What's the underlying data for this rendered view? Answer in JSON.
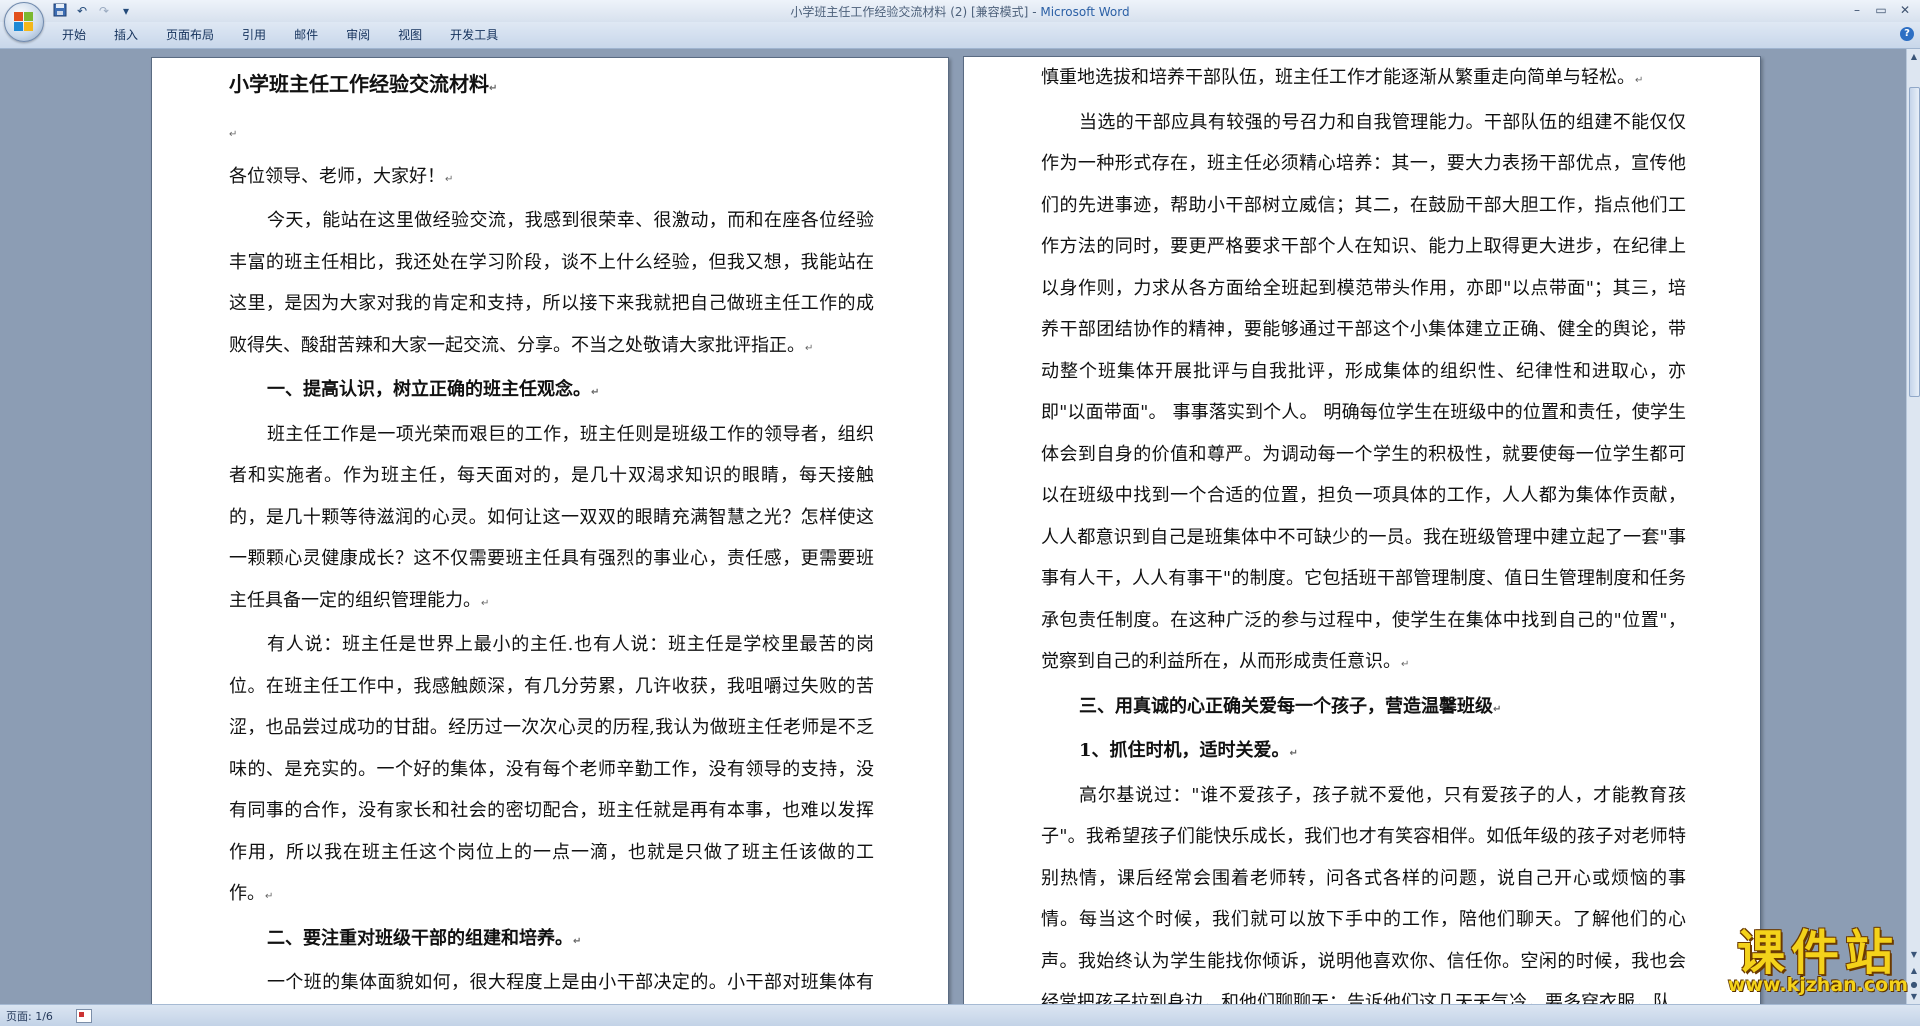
{
  "window": {
    "title": "小学班主任工作经验交流材料 (2) [兼容模式]",
    "title_sep": " - ",
    "app_name": "Microsoft Word",
    "min": "–",
    "max": "▭",
    "close": "✕"
  },
  "qat": {
    "save_icon": "floppy-disk-icon",
    "undo": "↶",
    "redo": "↷",
    "dropdown": "▾"
  },
  "ribbon": {
    "tabs": [
      "开始",
      "插入",
      "页面布局",
      "引用",
      "邮件",
      "审阅",
      "视图",
      "开发工具"
    ],
    "help": "?"
  },
  "left_page": {
    "title": "小学班主任工作经验交流材料",
    "salutation": "各位领导、老师，大家好！",
    "para1": "今天，能站在这里做经验交流，我感到很荣幸、很激动，而和在座各位经验丰富的班主任相比，我还处在学习阶段，谈不上什么经验，但我又想，我能站在这里，是因为大家对我的肯定和支持，所以接下来我就把自己做班主任工作的成败得失、酸甜苦辣和大家一起交流、分享。不当之处敬请大家批评指正。",
    "heading1": "一、提高认识，树立正确的班主任观念。",
    "para2": "班主任工作是一项光荣而艰巨的工作，班主任则是班级工作的领导者，组织者和实施者。作为班主任，每天面对的，是几十双渴求知识的眼睛，每天接触的，是几十颗等待滋润的心灵。如何让这一双双的眼睛充满智慧之光？怎样使这一颗颗心灵健康成长？这不仅需要班主任具有强烈的事业心，责任感，更需要班主任具备一定的组织管理能力。",
    "para3": "有人说：班主任是世界上最小的主任.也有人说：班主任是学校里最苦的岗位。在班主任工作中，我感触颇深，有几分劳累，几许收获，我咀嚼过失败的苦涩，也品尝过成功的甘甜。经历过一次次心灵的历程,我认为做班主任老师是不乏味的、是充实的。一个好的集体，没有每个老师辛勤工作，没有领导的支持，没有同事的合作，没有家长和社会的密切配合，班主任就是再有本事，也难以发挥作用，所以我在班主任这个岗位上的一点一滴，也就是只做了班主任该做的工作。",
    "heading2": "二、要注重对班级干部的组建和培养。",
    "para4": "一个班的集体面貌如何，很大程度上是由小干部决定的。小干部对班集体有着\"以点带面\"和\"以面带面\"的作用，我称他们是\"班主任的左右手。\"所以唯有"
  },
  "right_page": {
    "para1": "慎重地选拔和培养干部队伍，班主任工作才能逐渐从繁重走向简单与轻松。",
    "para2": "当选的干部应具有较强的号召力和自我管理能力。干部队伍的组建不能仅仅作为一种形式存在，班主任必须精心培养：其一，要大力表扬干部优点，宣传他们的先进事迹，帮助小干部树立威信；其二，在鼓励干部大胆工作，指点他们工作方法的同时，要更严格要求干部个人在知识、能力上取得更大进步，在纪律上以身作则，力求从各方面给全班起到模范带头作用，亦即\"以点带面\"；其三，培养干部团结协作的精神，要能够通过干部这个小集体建立正确、健全的舆论，带动整个班集体开展批评与自我批评，形成集体的组织性、纪律性和进取心，亦即\"以面带面\"。 事事落实到个人。 明确每位学生在班级中的位置和责任，使学生体会到自身的价值和尊严。为调动每一个学生的积极性，就要使每一位学生都可以在班级中找到一个合适的位置，担负一项具体的工作，人人都为集体作贡献，人人都意识到自己是班集体中不可缺少的一员。我在班级管理中建立起了一套\"事事有人干，人人有事干\"的制度。它包括班干部管理制度、值日生管理制度和任务承包责任制度。在这种广泛的参与过程中，使学生在集体中找到自己的\"位置\"，觉察到自己的利益所在，从而形成责任意识。",
    "heading3": "三、用真诚的心正确关爱每一个孩子，营造温馨班级",
    "heading3_1": "1、抓住时机，适时关爱。",
    "para3": "高尔基说过：\"谁不爱孩子，孩子就不爱他，只有爱孩子的人，才能教育孩子\"。我希望孩子们能快乐成长，我们也才有笑容相伴。如低年级的孩子对老师特别热情，课后经常会围着老师转，问各式各样的问题，说自己开心或烦恼的事情。每当这个时候，我们就可以放下手中的工作，陪他们聊天。了解他们的心声。我始终认为学生能找你倾诉，说明他喜欢你、信任你。空闲的时候，我也会经常把孩子拉到身边，和他们聊聊天：告诉他们这几天天气冷，要多穿衣服，队"
  },
  "para_mark": "↵",
  "status": {
    "page": "页面: 1/6"
  },
  "watermark": {
    "big": "课件站",
    "small": "www.kjzhan.com"
  }
}
